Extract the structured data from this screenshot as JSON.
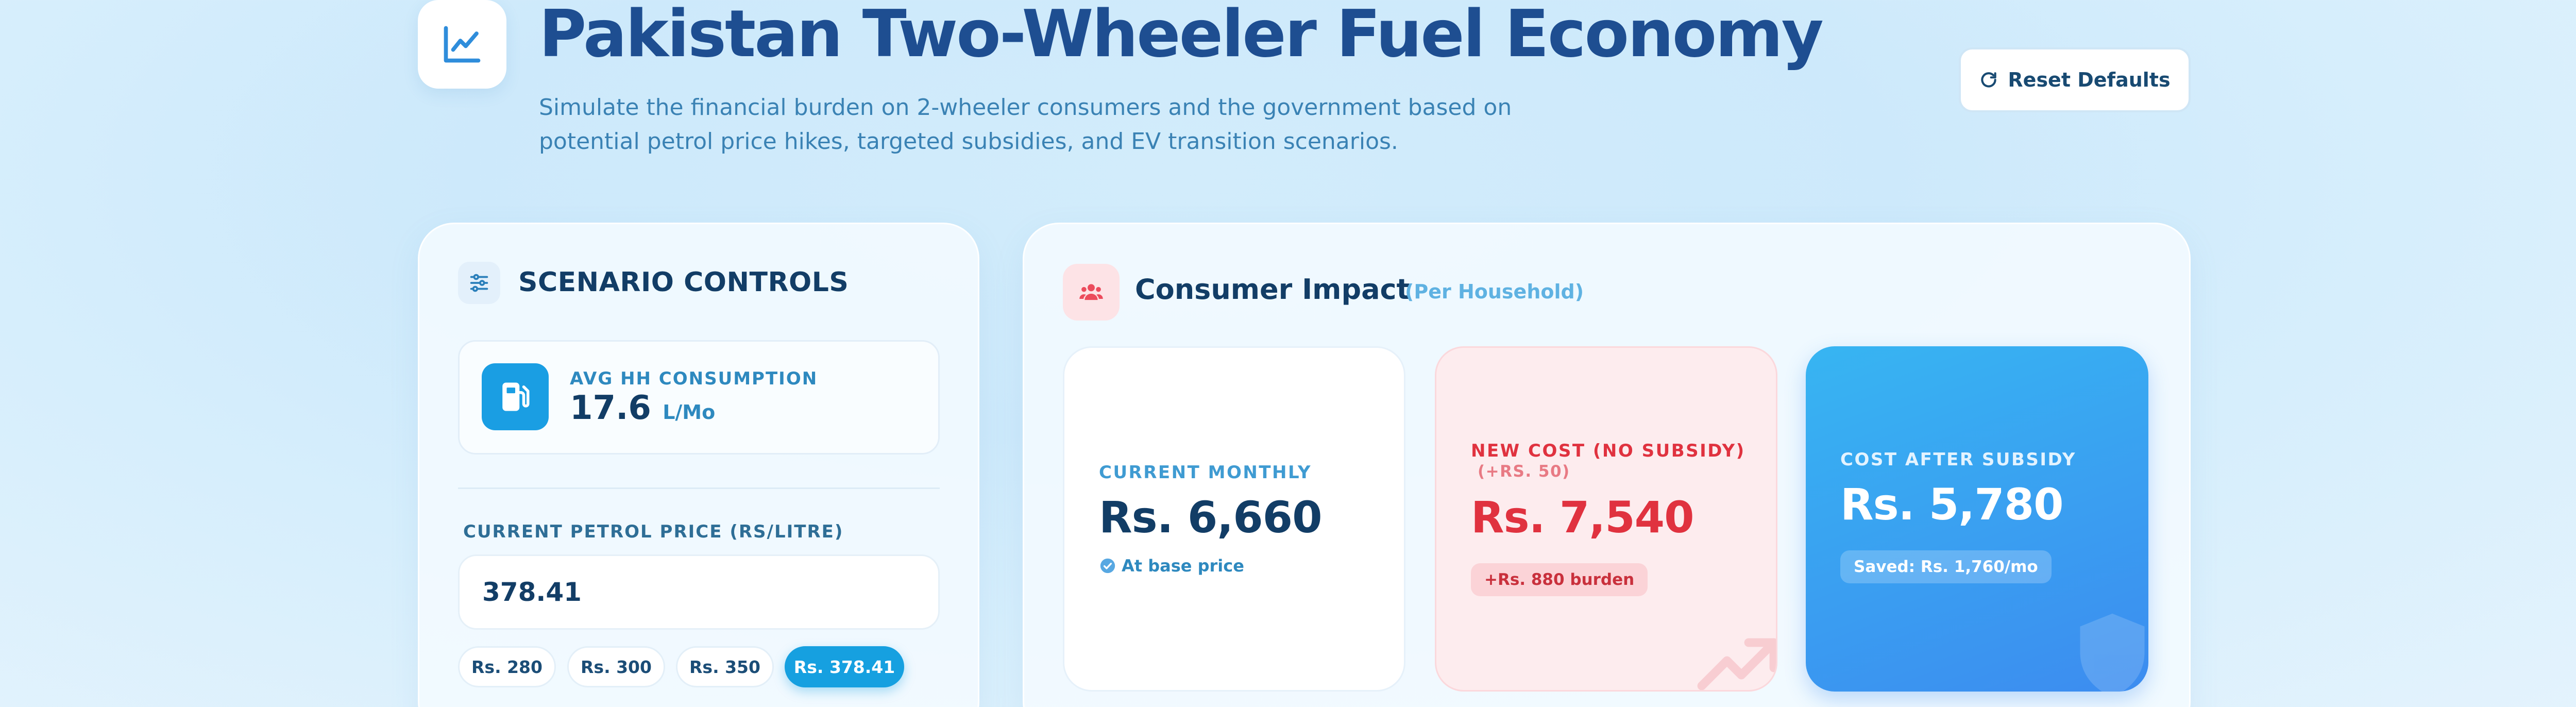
{
  "header": {
    "title": "Pakistan Two-Wheeler Fuel Economy",
    "subtitle": "Simulate the financial burden on 2-wheeler consumers and the government based on potential petrol price hikes, targeted subsidies, and EV transition scenarios.",
    "icon": "line-chart-icon",
    "reset_label": "Reset Defaults",
    "reset_icon": "refresh-icon"
  },
  "controls": {
    "title": "SCENARIO CONTROLS",
    "title_icon": "sliders-icon",
    "consumption": {
      "label": "AVG HH CONSUMPTION",
      "value": "17.6",
      "unit": "L/Mo",
      "icon": "fuel-pump-icon"
    },
    "price": {
      "label": "CURRENT PETROL PRICE (RS/LITRE)",
      "value": "378.41",
      "presets": [
        "Rs. 280",
        "Rs. 300",
        "Rs. 350",
        "Rs. 378.41"
      ],
      "selected": "Rs. 378.41"
    }
  },
  "impact": {
    "title": "Consumer Impact",
    "subtitle": "(Per Household)",
    "title_icon": "users-icon",
    "current": {
      "label": "CURRENT MONTHLY",
      "value": "Rs. 6,660",
      "note": "At base price",
      "note_icon": "check-circle-icon"
    },
    "new_cost": {
      "label": "NEW COST (NO SUBSIDY)",
      "delta": "(+RS. 50)",
      "value": "Rs. 7,540",
      "badge": "+Rs. 880 burden",
      "watermark_icon": "trending-up-icon"
    },
    "after_subsidy": {
      "label": "COST AFTER SUBSIDY",
      "value": "Rs. 5,780",
      "badge": "Saved: Rs. 1,760/mo",
      "watermark_icon": "shield-icon"
    }
  },
  "colors": {
    "title": "#1e4e91",
    "accent": "#16a0e0",
    "danger": "#e0323f",
    "subsidy_card": "#3c8cf0"
  }
}
